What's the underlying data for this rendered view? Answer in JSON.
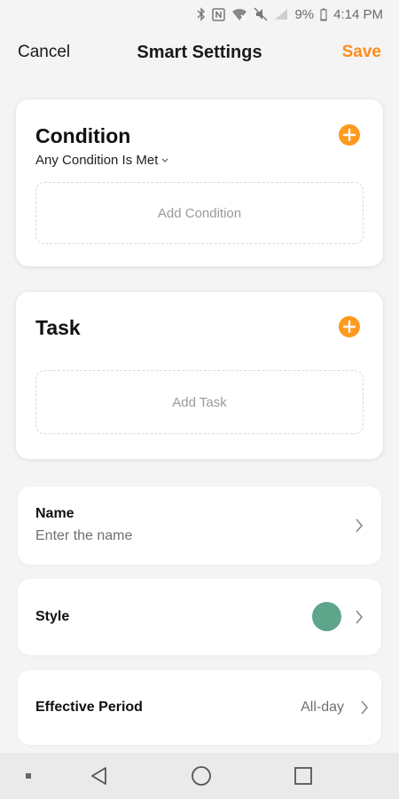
{
  "status_bar": {
    "battery": "9%",
    "time": "4:14 PM"
  },
  "header": {
    "cancel_label": "Cancel",
    "title": "Smart Settings",
    "save_label": "Save"
  },
  "condition": {
    "title": "Condition",
    "mode": "Any Condition Is Met",
    "add_placeholder": "Add Condition"
  },
  "task": {
    "title": "Task",
    "add_placeholder": "Add Task"
  },
  "name_row": {
    "label": "Name",
    "placeholder": "Enter the name"
  },
  "style_row": {
    "label": "Style",
    "color": "#5fa58b"
  },
  "period_row": {
    "label": "Effective Period",
    "value": "All-day"
  },
  "colors": {
    "accent": "#ff8c1a",
    "add_button": "#ff9a1f"
  }
}
